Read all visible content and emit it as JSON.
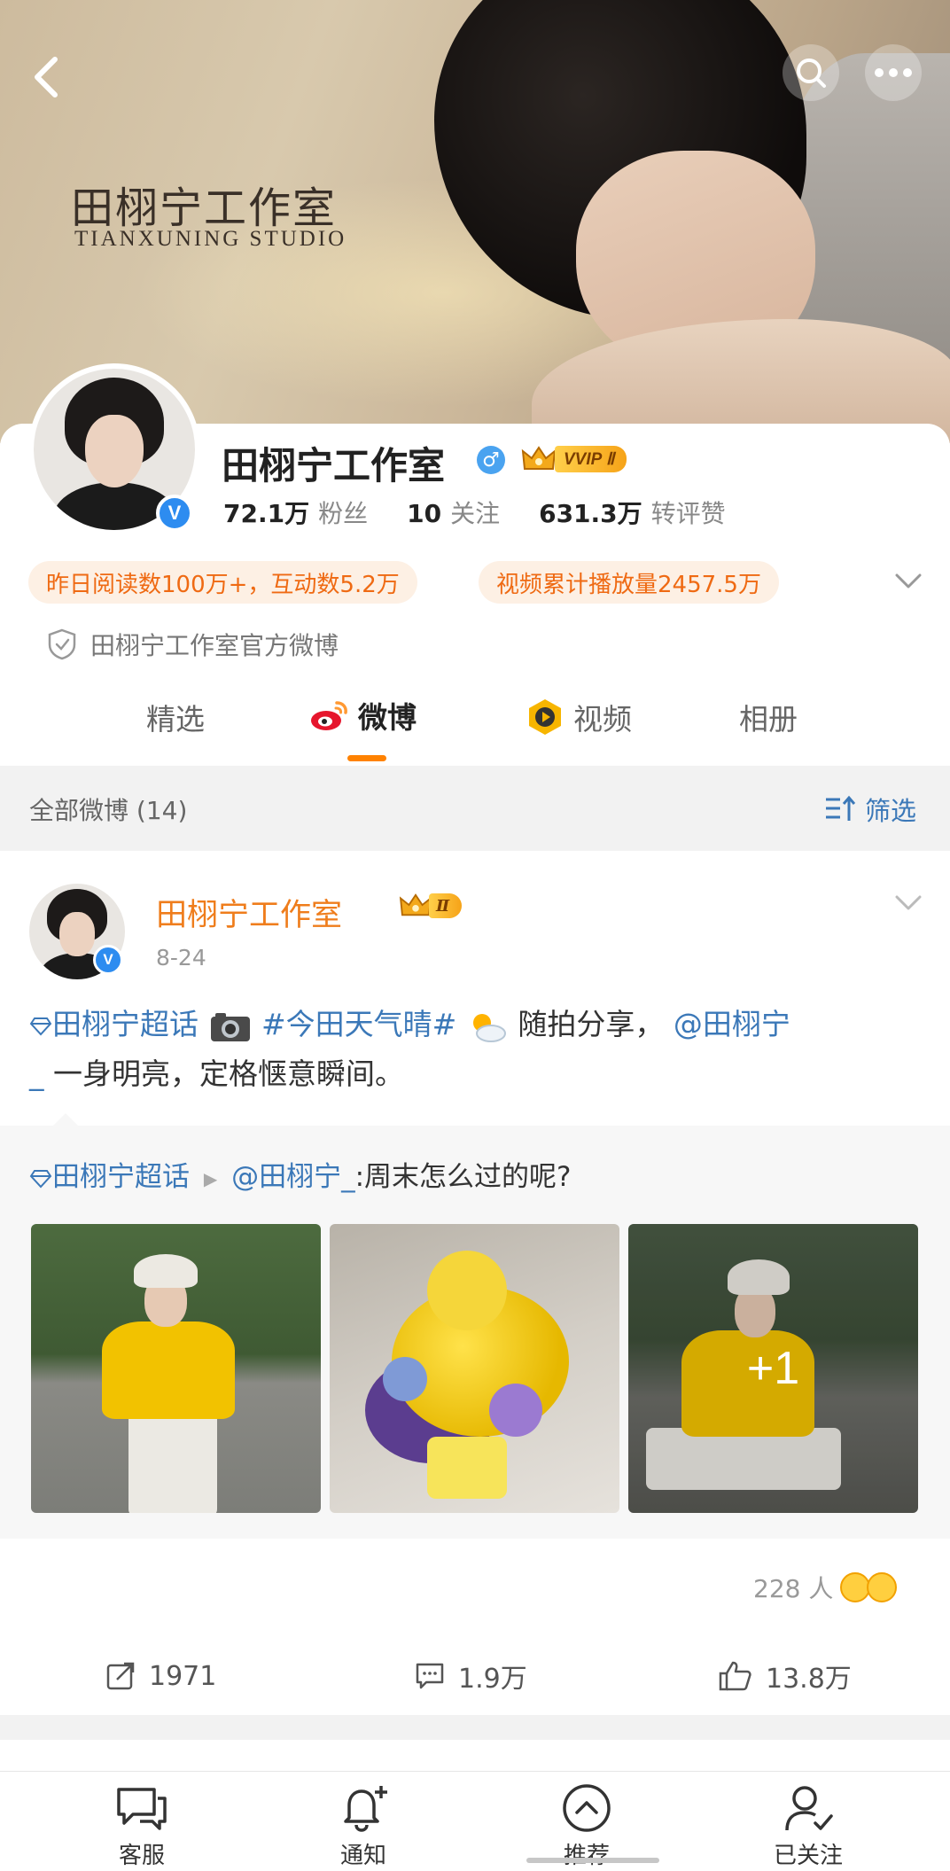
{
  "banner": {
    "title": "田栩宁工作室",
    "subtitle": "TIANXUNING STUDIO"
  },
  "profile": {
    "name": "田栩宁工作室",
    "gender_icon": "male-icon",
    "vip_label": "VVIP Ⅱ",
    "verified_badge": "V",
    "stats": [
      {
        "value": "72.1万",
        "label": "粉丝"
      },
      {
        "value": "10",
        "label": "关注"
      },
      {
        "value": "631.3万",
        "label": "转评赞"
      }
    ],
    "pills": [
      "昨日阅读数100万+，互动数5.2万",
      "视频累计播放量2457.5万"
    ],
    "official_text": "田栩宁工作室官方微博"
  },
  "tabs": [
    {
      "label": "精选"
    },
    {
      "label": "微博"
    },
    {
      "label": "视频"
    },
    {
      "label": "相册"
    }
  ],
  "filter": {
    "count_label": "全部微博 (14)",
    "filter_label": "筛选"
  },
  "post": {
    "author": "田栩宁工作室",
    "vip_label": "Ⅱ",
    "date": "8-24",
    "text_supertopic": "田栩宁超话",
    "text_hashtag": "#今田天气晴#",
    "text_mid": "随拍分享，",
    "text_mention": "@田栩宁",
    "text_mention_tail": "_",
    "text_end": "一身明亮，定格惬意瞬间。",
    "repost_topic": "田栩宁超话",
    "repost_mention": "@田栩宁_",
    "repost_text": ":周末怎么过的呢?",
    "more_images": "+1",
    "likers_count": "228 人",
    "actions": {
      "repost": "1971",
      "comment": "1.9万",
      "like": "13.8万"
    }
  },
  "bottom_nav": [
    {
      "label": "客服"
    },
    {
      "label": "通知"
    },
    {
      "label": "推荐"
    },
    {
      "label": "已关注"
    }
  ],
  "colors": {
    "accent_orange": "#ff8200",
    "link_blue": "#3b78b8",
    "pill_text": "#ef6a13",
    "pill_bg": "#fdf0e4"
  }
}
